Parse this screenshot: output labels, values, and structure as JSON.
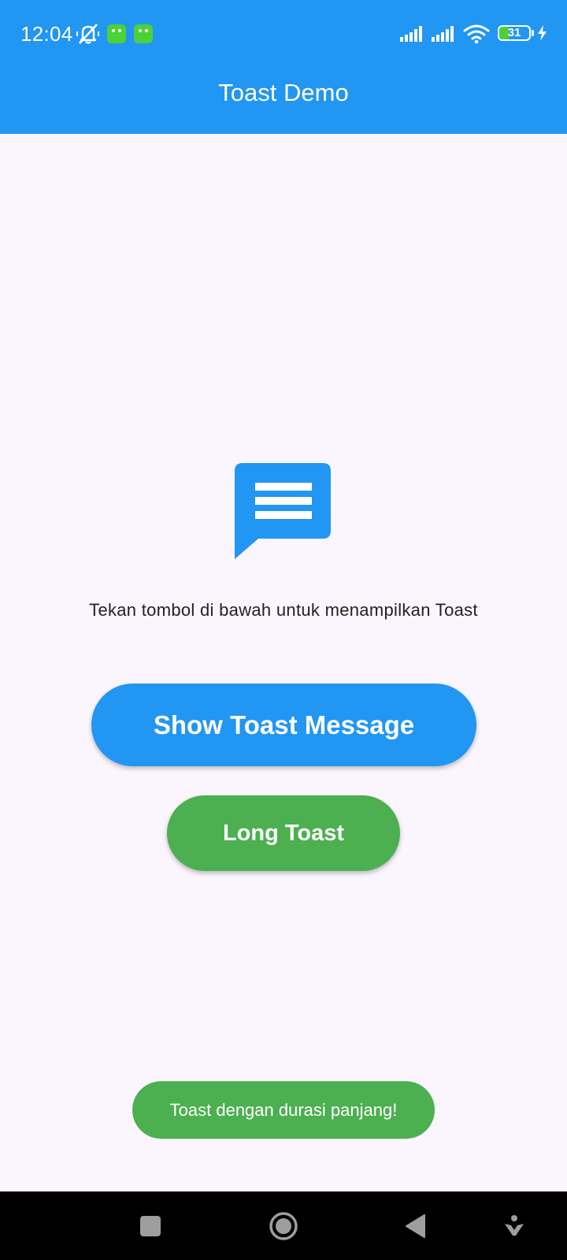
{
  "status_bar": {
    "time": "12:04",
    "battery_level": "31",
    "icons": [
      "mute-vibrate-icon",
      "app-notification-icon",
      "app-notification-icon",
      "signal-icon",
      "signal-icon",
      "wifi-icon",
      "battery-icon",
      "charging-icon"
    ]
  },
  "app_bar": {
    "title": "Toast Demo"
  },
  "main": {
    "icon": "message-icon",
    "instruction": "Tekan tombol di bawah untuk menampilkan Toast",
    "primary_button": "Show Toast Message",
    "secondary_button": "Long Toast"
  },
  "toast": {
    "message": "Toast dengan durasi panjang!"
  },
  "nav_bar": {
    "icons": [
      "recents-icon",
      "home-icon",
      "back-icon",
      "accessibility-icon"
    ]
  },
  "colors": {
    "primary": "#2196f3",
    "success": "#4caf50",
    "background": "#fbf5fd",
    "text": "#222222"
  }
}
